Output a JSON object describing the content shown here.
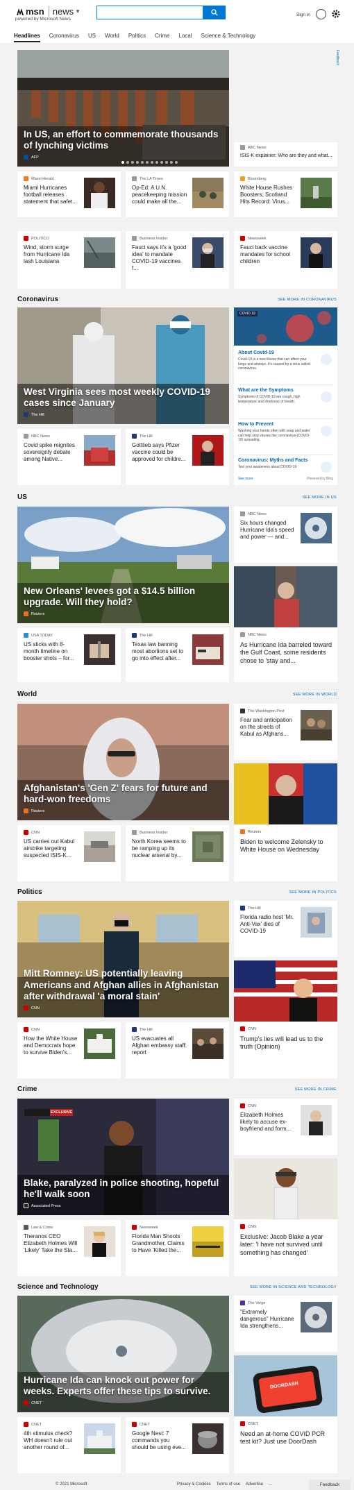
{
  "header": {
    "brand": "msn",
    "product": "news",
    "powered_by": "powered by Microsoft News",
    "search_placeholder": "",
    "sign_in": "Sign in"
  },
  "nav": [
    "Headlines",
    "Coronavirus",
    "US",
    "World",
    "Politics",
    "Crime",
    "Local",
    "Science & Technology"
  ],
  "feedback_tab": "Feedback",
  "top": {
    "hero": {
      "title": "In US, an effort to commemorate thousands of lynching victims",
      "source": "AFP"
    },
    "side": {
      "source": "ABC News",
      "title": "ISIS-K explainer: Who are they and what..."
    },
    "cards": [
      {
        "source": "Miami Herald",
        "title": "Miami Hurricanes football releases statement that safet..."
      },
      {
        "source": "The LA Times",
        "title": "Op-Ed: A U.N. peacekeeping mission could make all the..."
      },
      {
        "source": "Bloomberg",
        "title": "White House Rushes Boosters; Scotland Hits Record: Virus..."
      },
      {
        "source": "POLITICO",
        "title": "Wind, storm surge from Hurricane Ida lash Louisiana"
      },
      {
        "source": "Business Insider",
        "title": "Fauci says it's a 'good idea' to mandate COVID-19 vaccines f..."
      },
      {
        "source": "Newsweek",
        "title": "Fauci back vaccine mandates for school children"
      }
    ]
  },
  "coronavirus": {
    "title": "Coronavirus",
    "see_more": "SEE MORE IN CORONAVIRUS",
    "hero": {
      "title": "West Virginia sees most weekly COVID-19 cases since January",
      "source": "The Hill"
    },
    "cards": [
      {
        "source": "NBC News",
        "title": "Covid spike reignites sovereignty debate among Native..."
      },
      {
        "source": "The Hill",
        "title": "Gottlieb says Pfizer vaccine could be approved for childre..."
      }
    ],
    "widget": {
      "badge": "COVID 19",
      "items": [
        {
          "heading": "About Covid-19",
          "desc": "Covid-19 is a new illness that can affect your lungs and airways. It's caused by a virus called coronavirus."
        },
        {
          "heading": "What are the Symptoms",
          "desc": "Symptoms of COVID-19 are cough, high temperature and shortness of breath."
        },
        {
          "heading": "How to Prevent",
          "desc": "Washing your hands often with soap and water can help stop viruses like coronavirus (COVID-19) spreading."
        },
        {
          "heading": "Coronavirus: Myths and Facts",
          "desc": "Test your awareness about COVID-19"
        }
      ],
      "see_more": "See more",
      "powered": "Powered by Bing"
    }
  },
  "us": {
    "title": "US",
    "see_more": "SEE MORE IN US",
    "hero": {
      "title": "New Orleans' levees got a $14.5 billion upgrade. Will they hold?",
      "source": "Reuters"
    },
    "side_top": {
      "source": "NBC News",
      "title": "Six hours changed Hurricane Ida's speed and power — and..."
    },
    "side_big": {
      "source": "NBC News",
      "title": "As Hurricane Ida barreled toward the Gulf Coast, some residents chose to 'stay and..."
    },
    "cards": [
      {
        "source": "USA TODAY",
        "title": "US sticks with 8-month timeline on booster shots – for..."
      },
      {
        "source": "The Hill",
        "title": "Texas law banning most abortions set to go into effect after..."
      }
    ]
  },
  "world": {
    "title": "World",
    "see_more": "SEE MORE IN WORLD",
    "hero": {
      "title": "Afghanistan's 'Gen Z' fears for future and hard-won freedoms",
      "source": "Reuters"
    },
    "side_top": {
      "source": "The Washington Post",
      "title": "Fear and anticipation on the streets of Kabul as Afghans..."
    },
    "side_big": {
      "source": "Reuters",
      "title": "Biden to welcome Zelensky to White House on Wednesday"
    },
    "cards": [
      {
        "source": "CNN",
        "title": "US carries out Kabul airstrike targeting suspected ISIS-K..."
      },
      {
        "source": "Business Insider",
        "title": "North Korea seems to be ramping up its nuclear arsenal by..."
      }
    ]
  },
  "politics": {
    "title": "Politics",
    "see_more": "SEE MORE IN POLITICS",
    "hero": {
      "title": "Mitt Romney: US potentially leaving Americans and Afghan allies in Afghanistan after withdrawal 'a moral stain'",
      "source": "CNN"
    },
    "side_top": {
      "source": "The Hill",
      "title": "Florida radio host 'Mr. Anti-Vax' dies of COVID-19"
    },
    "side_big": {
      "source": "CNN",
      "title": "Trump's lies will lead us to the truth (Opinion)"
    },
    "cards": [
      {
        "source": "CNN",
        "title": "How the White House and Democrats hope to survive Biden's..."
      },
      {
        "source": "The Hill",
        "title": "US evacuates all Afghan embassy staff: report"
      }
    ]
  },
  "crime": {
    "title": "Crime",
    "see_more": "SEE MORE IN CRIME",
    "hero": {
      "title": "Blake, paralyzed in police shooting, hopeful he'll walk soon",
      "source": "Associated Press",
      "banner": "EXCLUSIVE"
    },
    "side_top": {
      "source": "CNN",
      "title": "Elizabeth Holmes likely to accuse ex-boyfriend and form..."
    },
    "side_big": {
      "source": "CNN",
      "title": "Exclusive: Jacob Blake a year later: 'I have not survived until something has changed'"
    },
    "cards": [
      {
        "source": "Law & Crime",
        "title": "Theranos CEO Elizabeth Holmes Will 'Likely' Take the Sta..."
      },
      {
        "source": "Newsweek",
        "title": "Florida Man Shoots Grandmother, Claims to Have 'Killed the..."
      }
    ]
  },
  "scitech": {
    "title": "Science and Technology",
    "see_more": "SEE MORE IN SCIENCE AND TECHNOLOGY",
    "hero": {
      "title": "Hurricane Ida can knock out power for weeks. Experts offer these tips to survive.",
      "source": "CNET"
    },
    "side_top": {
      "source": "The Verge",
      "title": "\"Extremely dangerous\" Hurricane Ida strengthens..."
    },
    "side_big": {
      "source": "CNET",
      "title": "Need an at-home COVID PCR test kit? Just use DoorDash",
      "img_text": "DOORDASH"
    },
    "cards": [
      {
        "source": "CNET",
        "title": "4th stimulus check? WH doesn't rule out another round of..."
      },
      {
        "source": "CNET",
        "title": "Google Nest: 7 commands you should be using eve..."
      }
    ]
  },
  "footer": {
    "copyright": "© 2021 Microsoft",
    "links": [
      "Privacy & Cookies",
      "Terms of use",
      "Advertise",
      "..."
    ],
    "feedback": "Feedback"
  }
}
